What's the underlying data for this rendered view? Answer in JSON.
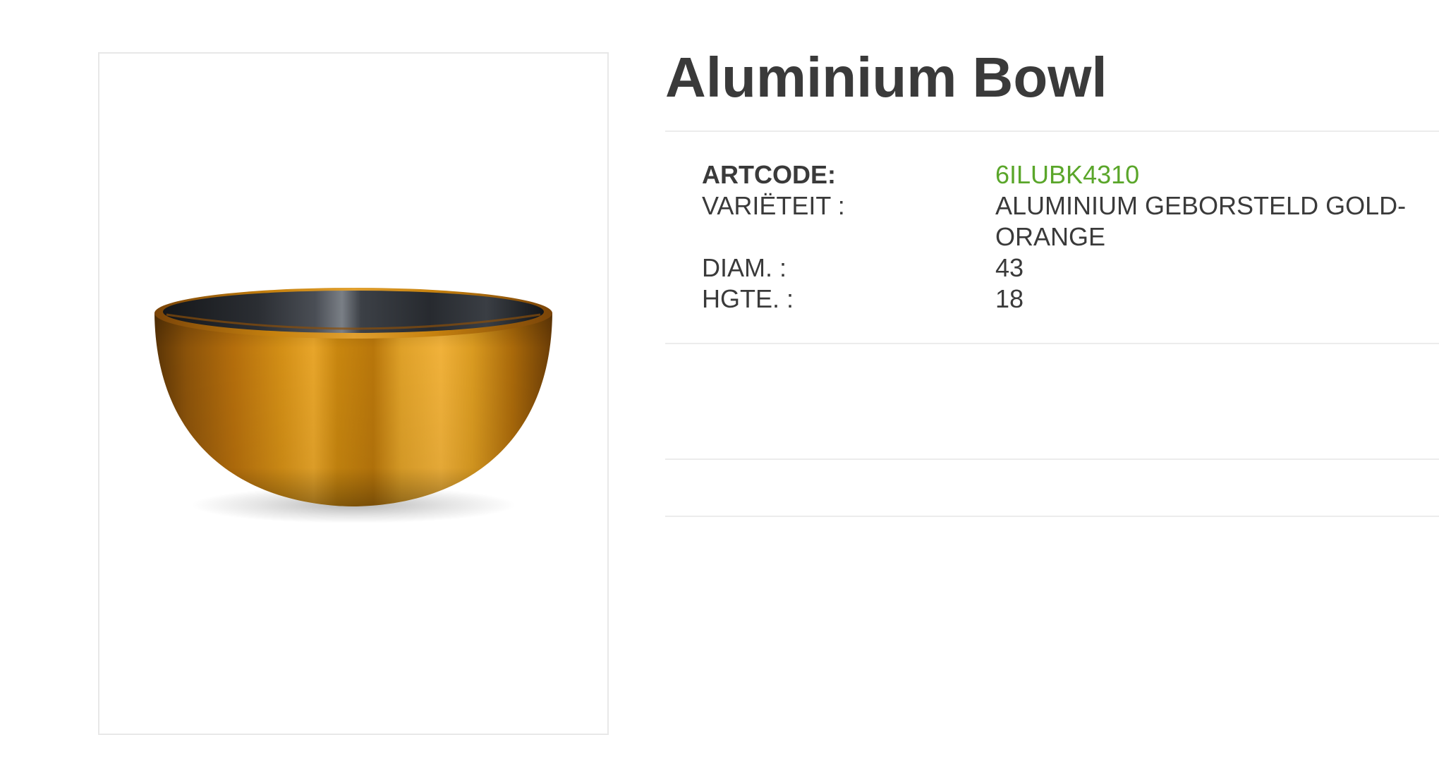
{
  "product": {
    "title": "Aluminium Bowl",
    "image": {
      "subject": "bowl-photo",
      "exterior_color": "#c8820f",
      "interior_color": "#2a2c30"
    }
  },
  "specs": [
    {
      "label": "ARTCODE:",
      "value": "6ILUBK4310"
    },
    {
      "label": "VARIËTEIT :",
      "value": "ALUMINIUM GEBORSTELD GOLD-ORANGE"
    },
    {
      "label": "DIAM. :",
      "value": "43"
    },
    {
      "label": "HGTE. :",
      "value": "18"
    }
  ],
  "colors": {
    "title_text": "#3a3a3a",
    "accent_green": "#5aa62a",
    "divider": "#ececec",
    "frame_border": "#e8e8e8"
  }
}
